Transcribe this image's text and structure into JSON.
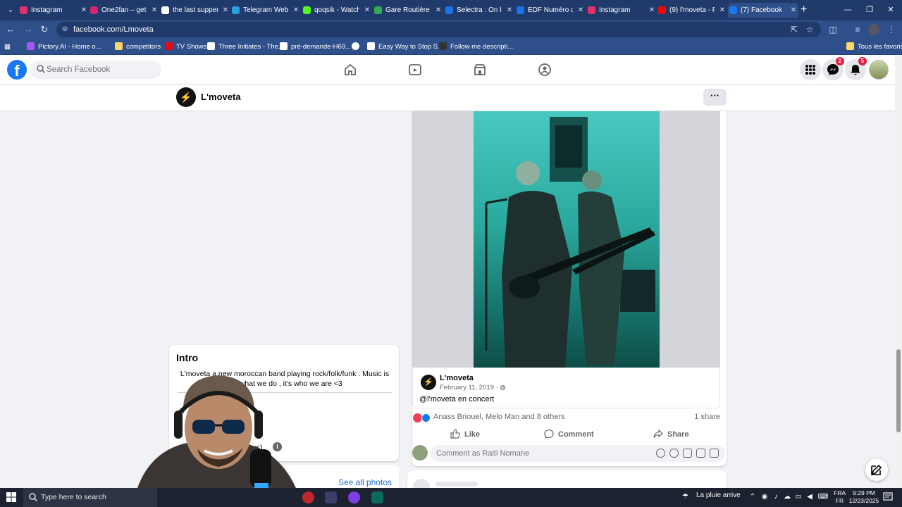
{
  "browser": {
    "tabs": [
      {
        "title": "Instagram",
        "color": "#e1306c"
      },
      {
        "title": "One2fan – get",
        "color": "#d6246e"
      },
      {
        "title": "the last supper",
        "color": "#ffffff"
      },
      {
        "title": "Telegram Web",
        "color": "#2aa1da"
      },
      {
        "title": "qoqsik - Watch",
        "color": "#53fc18"
      },
      {
        "title": "Gare Routière",
        "color": "#34a853"
      },
      {
        "title": "Selectra : On le",
        "color": "#1a73e8"
      },
      {
        "title": "EDF Numéro d",
        "color": "#1a73e8"
      },
      {
        "title": "Instagram",
        "color": "#e1306c"
      },
      {
        "title": "(9) l'moveta - F",
        "color": "#ff0000"
      },
      {
        "title": "(7) Facebook",
        "color": "#1877f2"
      }
    ],
    "url": "facebook.com/Lmoveta",
    "bookmarks": [
      {
        "label": "Pictory.AI - Home o...",
        "color": "#a855f7"
      },
      {
        "label": "competitors",
        "color": "#ffd666"
      },
      {
        "label": "TV Shows",
        "color": "#e50914"
      },
      {
        "label": "Three Initiates - The...",
        "color": "#ffffff"
      },
      {
        "label": "pré-demande-H69...",
        "color": "#ffffff"
      },
      {
        "label": "",
        "color": "#ffffff"
      },
      {
        "label": "Easy Way to Stop S...",
        "color": "#ffffff"
      },
      {
        "label": "Follow me descripti...",
        "color": "#333333"
      }
    ],
    "all_bookmarks": "Tous les favoris"
  },
  "facebook": {
    "search_placeholder": "Search Facebook",
    "messenger_badge": "2",
    "notif_badge": "5",
    "page_name": "L'moveta",
    "more_label": "···"
  },
  "post": {
    "author": "L'moveta",
    "date": "February 11, 2019 · ",
    "caption": "@l'moveta en concert",
    "reactions": "Anass Briouel, Melo Man and 8 others",
    "shares": "1 share",
    "like": "Like",
    "comment": "Comment",
    "share": "Share",
    "comment_placeholder": "Comment as Raiti Nomane"
  },
  "intro": {
    "title": "Intro",
    "text": "L'moveta a new moroccan band playing rock/folk/funk . Music is not what we do , it's who we are <3",
    "reviews": "(reviews)",
    "see_all": "See all photos"
  },
  "taskbar": {
    "search": "Type here to search",
    "weather": "La pluie arrive",
    "lang1": "FRA",
    "lang2": "FR",
    "time": "9:29 PM",
    "date": "12/23/2025"
  }
}
